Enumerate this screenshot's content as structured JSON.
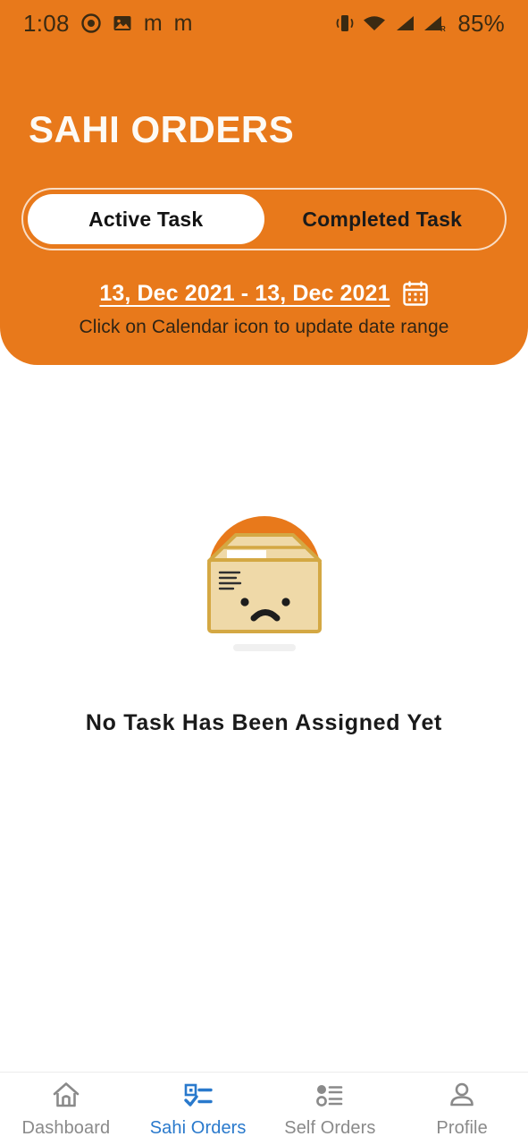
{
  "status_bar": {
    "time": "1:08",
    "left_icons": [
      "chrome-icon",
      "image-icon",
      "gmail-icon",
      "gmail-icon-2"
    ],
    "right_icons": [
      "vibrate-icon",
      "wifi-icon",
      "signal-icon",
      "signal-roaming-icon"
    ],
    "battery": "85%"
  },
  "header": {
    "title": "SAHI ORDERS",
    "accent_color": "#E8791B",
    "tabs": [
      {
        "label": "Active Task",
        "active": true
      },
      {
        "label": "Completed Task",
        "active": false
      }
    ],
    "date_range": "13, Dec 2021 - 13, Dec 2021",
    "calendar_icon": "calendar-icon",
    "date_hint": "Click on Calendar icon to update date range"
  },
  "empty_state": {
    "illustration": "sad-box-icon",
    "message": "No Task Has Been Assigned Yet"
  },
  "bottom_nav": {
    "active_color": "#2979cc",
    "inactive_color": "#8a8a8a",
    "items": [
      {
        "label": "Dashboard",
        "icon": "home-icon",
        "active": false
      },
      {
        "label": "Sahi Orders",
        "icon": "checklist-icon",
        "active": true
      },
      {
        "label": "Self Orders",
        "icon": "list-icon",
        "active": false
      },
      {
        "label": "Profile",
        "icon": "person-icon",
        "active": false
      }
    ]
  }
}
